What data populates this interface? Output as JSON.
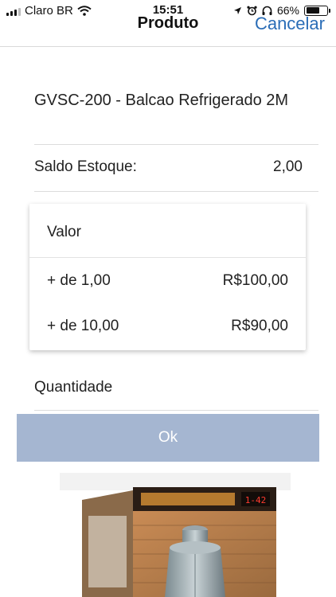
{
  "status_bar": {
    "carrier": "Claro BR",
    "time": "15:51",
    "battery": "66%",
    "battery_level": 0.66
  },
  "nav": {
    "title": "Produto",
    "cancel_label": "Cancelar"
  },
  "product": {
    "name": "GVSC-200 - Balcao Refrigerado 2M",
    "stock_label": "Saldo Estoque:",
    "stock_value": "2,00",
    "image_display_text": "1-42"
  },
  "prices": {
    "header": "Valor",
    "tiers": [
      {
        "qty": "+ de 1,00",
        "price": "R$100,00"
      },
      {
        "qty": "+ de 10,00",
        "price": "R$90,00"
      }
    ]
  },
  "quantity": {
    "label": "Quantidade"
  },
  "ok_label": "Ok",
  "colors": {
    "accent": "#2a6db7",
    "ok_button": "#a5b6d1"
  }
}
